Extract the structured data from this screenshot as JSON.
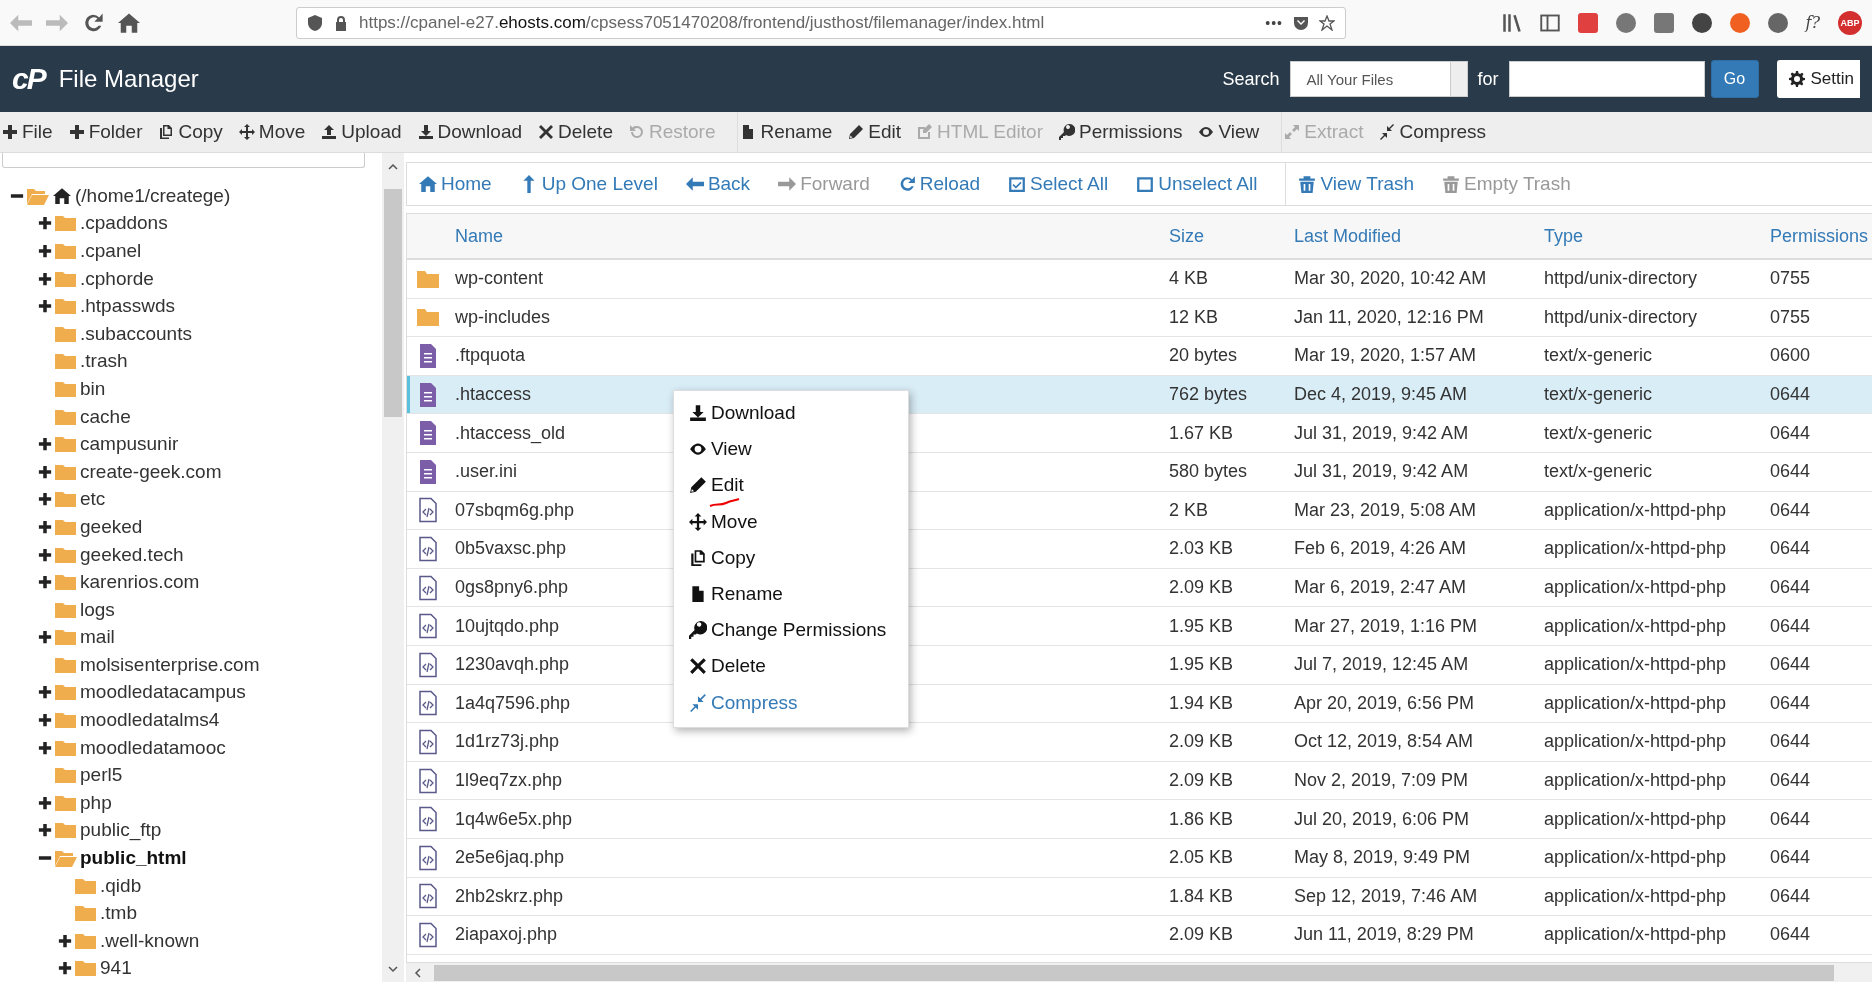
{
  "browser": {
    "url": "https://cpanel-e27.**ehosts.com**/cpsess7051470208/frontend/justhost/filemanager/index.html",
    "more": "•••",
    "extension_labels": [
      "f?",
      "ABP"
    ]
  },
  "header": {
    "logo": "cP",
    "title": "File Manager",
    "search_label": "Search",
    "scope": "All Your Files",
    "for_label": "for",
    "go": "Go",
    "settings": "Settin"
  },
  "toolbar": [
    {
      "items": [
        {
          "label": "File",
          "disabled": false
        },
        {
          "label": "Folder",
          "disabled": false
        },
        {
          "label": "Copy",
          "disabled": false
        },
        {
          "label": "Move",
          "disabled": false
        },
        {
          "label": "Upload",
          "disabled": false
        },
        {
          "label": "Download",
          "disabled": false
        },
        {
          "label": "Delete",
          "disabled": false
        },
        {
          "label": "Restore",
          "disabled": true
        }
      ]
    },
    {
      "items": [
        {
          "label": "Rename",
          "disabled": false
        },
        {
          "label": "Edit",
          "disabled": false
        },
        {
          "label": "HTML Editor",
          "disabled": true
        },
        {
          "label": "Permissions",
          "disabled": false
        },
        {
          "label": "View",
          "disabled": false
        }
      ]
    },
    {
      "items": [
        {
          "label": "Extract",
          "disabled": true
        },
        {
          "label": "Compress",
          "disabled": false
        }
      ]
    }
  ],
  "tree": [
    {
      "label": "(/home1/createge)",
      "kind": "root",
      "expandable": true,
      "expanded": true,
      "selected": false,
      "children": [
        {
          "label": ".cpaddons",
          "expandable": true,
          "expanded": false,
          "selected": false
        },
        {
          "label": ".cpanel",
          "expandable": true,
          "expanded": false,
          "selected": false
        },
        {
          "label": ".cphorde",
          "expandable": true,
          "expanded": false,
          "selected": false
        },
        {
          "label": ".htpasswds",
          "expandable": true,
          "expanded": false,
          "selected": false
        },
        {
          "label": ".subaccounts",
          "expandable": false,
          "expanded": false,
          "selected": false
        },
        {
          "label": ".trash",
          "expandable": false,
          "expanded": false,
          "selected": false
        },
        {
          "label": "bin",
          "expandable": false,
          "expanded": false,
          "selected": false
        },
        {
          "label": "cache",
          "expandable": false,
          "expanded": false,
          "selected": false
        },
        {
          "label": "campusunir",
          "expandable": true,
          "expanded": false,
          "selected": false
        },
        {
          "label": "create-geek.com",
          "expandable": true,
          "expanded": false,
          "selected": false
        },
        {
          "label": "etc",
          "expandable": true,
          "expanded": false,
          "selected": false
        },
        {
          "label": "geeked",
          "expandable": true,
          "expanded": false,
          "selected": false
        },
        {
          "label": "geeked.tech",
          "expandable": true,
          "expanded": false,
          "selected": false
        },
        {
          "label": "karenrios.com",
          "expandable": true,
          "expanded": false,
          "selected": false
        },
        {
          "label": "logs",
          "expandable": false,
          "expanded": false,
          "selected": false
        },
        {
          "label": "mail",
          "expandable": true,
          "expanded": false,
          "selected": false
        },
        {
          "label": "molsisenterprise.com",
          "expandable": false,
          "expanded": false,
          "selected": false
        },
        {
          "label": "moodledatacampus",
          "expandable": true,
          "expanded": false,
          "selected": false
        },
        {
          "label": "moodledatalms4",
          "expandable": true,
          "expanded": false,
          "selected": false
        },
        {
          "label": "moodledatamooc",
          "expandable": true,
          "expanded": false,
          "selected": false
        },
        {
          "label": "perl5",
          "expandable": false,
          "expanded": false,
          "selected": false
        },
        {
          "label": "php",
          "expandable": true,
          "expanded": false,
          "selected": false
        },
        {
          "label": "public_ftp",
          "expandable": true,
          "expanded": false,
          "selected": false
        },
        {
          "label": "public_html",
          "expandable": true,
          "expanded": true,
          "selected": true,
          "children": [
            {
              "label": ".qidb",
              "expandable": false,
              "expanded": false,
              "selected": false
            },
            {
              "label": ".tmb",
              "expandable": false,
              "expanded": false,
              "selected": false
            },
            {
              "label": ".well-known",
              "expandable": true,
              "expanded": false,
              "selected": false
            },
            {
              "label": "941",
              "expandable": true,
              "expanded": false,
              "selected": false
            }
          ]
        }
      ]
    }
  ],
  "nav": [
    {
      "items": [
        {
          "label": "Home",
          "disabled": false
        },
        {
          "label": "Up One Level",
          "disabled": false
        },
        {
          "label": "Back",
          "disabled": false
        },
        {
          "label": "Forward",
          "disabled": true
        },
        {
          "label": "Reload",
          "disabled": false
        },
        {
          "label": "Select All",
          "disabled": false
        },
        {
          "label": "Unselect All",
          "disabled": false
        }
      ]
    },
    {
      "items": [
        {
          "label": "View Trash",
          "disabled": false
        },
        {
          "label": "Empty Trash",
          "disabled": true
        }
      ]
    }
  ],
  "table": {
    "columns": [
      "Name",
      "Size",
      "Last Modified",
      "Type",
      "Permissions"
    ],
    "rows": [
      {
        "kind": "folder",
        "name": "wp-content",
        "size": "4 KB",
        "modified": "Mar 30, 2020, 10:42 AM",
        "type": "httpd/unix-directory",
        "permissions": "0755",
        "selected": false
      },
      {
        "kind": "folder",
        "name": "wp-includes",
        "size": "12 KB",
        "modified": "Jan 11, 2020, 12:16 PM",
        "type": "httpd/unix-directory",
        "permissions": "0755",
        "selected": false
      },
      {
        "kind": "text",
        "name": ".ftpquota",
        "size": "20 bytes",
        "modified": "Mar 19, 2020, 1:57 AM",
        "type": "text/x-generic",
        "permissions": "0600",
        "selected": false
      },
      {
        "kind": "text",
        "name": ".htaccess",
        "size": "762 bytes",
        "modified": "Dec 4, 2019, 9:45 AM",
        "type": "text/x-generic",
        "permissions": "0644",
        "selected": true
      },
      {
        "kind": "text",
        "name": ".htaccess_old",
        "size": "1.67 KB",
        "modified": "Jul 31, 2019, 9:42 AM",
        "type": "text/x-generic",
        "permissions": "0644",
        "selected": false
      },
      {
        "kind": "text",
        "name": ".user.ini",
        "size": "580 bytes",
        "modified": "Jul 31, 2019, 9:42 AM",
        "type": "text/x-generic",
        "permissions": "0644",
        "selected": false
      },
      {
        "kind": "php",
        "name": "07sbqm6g.php",
        "size": "2 KB",
        "modified": "Mar 23, 2019, 5:08 AM",
        "type": "application/x-httpd-php",
        "permissions": "0644",
        "selected": false
      },
      {
        "kind": "php",
        "name": "0b5vaxsc.php",
        "size": "2.03 KB",
        "modified": "Feb 6, 2019, 4:26 AM",
        "type": "application/x-httpd-php",
        "permissions": "0644",
        "selected": false
      },
      {
        "kind": "php",
        "name": "0gs8pny6.php",
        "size": "2.09 KB",
        "modified": "Mar 6, 2019, 2:47 AM",
        "type": "application/x-httpd-php",
        "permissions": "0644",
        "selected": false
      },
      {
        "kind": "php",
        "name": "10ujtqdo.php",
        "size": "1.95 KB",
        "modified": "Mar 27, 2019, 1:16 PM",
        "type": "application/x-httpd-php",
        "permissions": "0644",
        "selected": false
      },
      {
        "kind": "php",
        "name": "1230avqh.php",
        "size": "1.95 KB",
        "modified": "Jul 7, 2019, 12:45 AM",
        "type": "application/x-httpd-php",
        "permissions": "0644",
        "selected": false
      },
      {
        "kind": "php",
        "name": "1a4q7596.php",
        "size": "1.94 KB",
        "modified": "Apr 20, 2019, 6:56 PM",
        "type": "application/x-httpd-php",
        "permissions": "0644",
        "selected": false
      },
      {
        "kind": "php",
        "name": "1d1rz73j.php",
        "size": "2.09 KB",
        "modified": "Oct 12, 2019, 8:54 AM",
        "type": "application/x-httpd-php",
        "permissions": "0644",
        "selected": false
      },
      {
        "kind": "php",
        "name": "1l9eq7zx.php",
        "size": "2.09 KB",
        "modified": "Nov 2, 2019, 7:09 PM",
        "type": "application/x-httpd-php",
        "permissions": "0644",
        "selected": false
      },
      {
        "kind": "php",
        "name": "1q4w6e5x.php",
        "size": "1.86 KB",
        "modified": "Jul 20, 2019, 6:06 PM",
        "type": "application/x-httpd-php",
        "permissions": "0644",
        "selected": false
      },
      {
        "kind": "php",
        "name": "2e5e6jaq.php",
        "size": "2.05 KB",
        "modified": "May 8, 2019, 9:49 PM",
        "type": "application/x-httpd-php",
        "permissions": "0644",
        "selected": false
      },
      {
        "kind": "php",
        "name": "2hb2skrz.php",
        "size": "1.84 KB",
        "modified": "Sep 12, 2019, 7:46 AM",
        "type": "application/x-httpd-php",
        "permissions": "0644",
        "selected": false
      },
      {
        "kind": "php",
        "name": "2iapaxoj.php",
        "size": "2.09 KB",
        "modified": "Jun 11, 2019, 8:29 PM",
        "type": "application/x-httpd-php",
        "permissions": "0644",
        "selected": false
      }
    ]
  },
  "context_menu": [
    {
      "label": "Download",
      "highlighted": false
    },
    {
      "label": "View",
      "highlighted": false
    },
    {
      "label": "Edit",
      "highlighted": false
    },
    {
      "label": "Move",
      "highlighted": false
    },
    {
      "label": "Copy",
      "highlighted": false
    },
    {
      "label": "Rename",
      "highlighted": false
    },
    {
      "label": "Change Permissions",
      "highlighted": false
    },
    {
      "label": "Delete",
      "highlighted": false
    },
    {
      "label": "Compress",
      "highlighted": true
    }
  ]
}
